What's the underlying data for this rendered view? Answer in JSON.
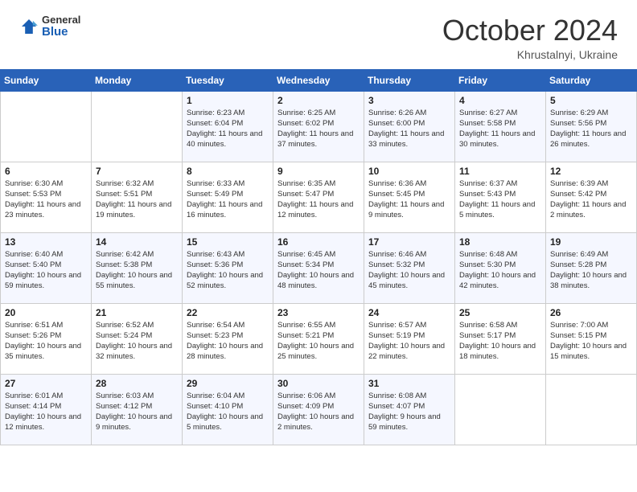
{
  "header": {
    "logo_general": "General",
    "logo_blue": "Blue",
    "month_title": "October 2024",
    "location": "Khrustalnyi, Ukraine"
  },
  "weekdays": [
    "Sunday",
    "Monday",
    "Tuesday",
    "Wednesday",
    "Thursday",
    "Friday",
    "Saturday"
  ],
  "weeks": [
    [
      {
        "day": "",
        "info": ""
      },
      {
        "day": "",
        "info": ""
      },
      {
        "day": "1",
        "info": "Sunrise: 6:23 AM\nSunset: 6:04 PM\nDaylight: 11 hours and 40 minutes."
      },
      {
        "day": "2",
        "info": "Sunrise: 6:25 AM\nSunset: 6:02 PM\nDaylight: 11 hours and 37 minutes."
      },
      {
        "day": "3",
        "info": "Sunrise: 6:26 AM\nSunset: 6:00 PM\nDaylight: 11 hours and 33 minutes."
      },
      {
        "day": "4",
        "info": "Sunrise: 6:27 AM\nSunset: 5:58 PM\nDaylight: 11 hours and 30 minutes."
      },
      {
        "day": "5",
        "info": "Sunrise: 6:29 AM\nSunset: 5:56 PM\nDaylight: 11 hours and 26 minutes."
      }
    ],
    [
      {
        "day": "6",
        "info": "Sunrise: 6:30 AM\nSunset: 5:53 PM\nDaylight: 11 hours and 23 minutes."
      },
      {
        "day": "7",
        "info": "Sunrise: 6:32 AM\nSunset: 5:51 PM\nDaylight: 11 hours and 19 minutes."
      },
      {
        "day": "8",
        "info": "Sunrise: 6:33 AM\nSunset: 5:49 PM\nDaylight: 11 hours and 16 minutes."
      },
      {
        "day": "9",
        "info": "Sunrise: 6:35 AM\nSunset: 5:47 PM\nDaylight: 11 hours and 12 minutes."
      },
      {
        "day": "10",
        "info": "Sunrise: 6:36 AM\nSunset: 5:45 PM\nDaylight: 11 hours and 9 minutes."
      },
      {
        "day": "11",
        "info": "Sunrise: 6:37 AM\nSunset: 5:43 PM\nDaylight: 11 hours and 5 minutes."
      },
      {
        "day": "12",
        "info": "Sunrise: 6:39 AM\nSunset: 5:42 PM\nDaylight: 11 hours and 2 minutes."
      }
    ],
    [
      {
        "day": "13",
        "info": "Sunrise: 6:40 AM\nSunset: 5:40 PM\nDaylight: 10 hours and 59 minutes."
      },
      {
        "day": "14",
        "info": "Sunrise: 6:42 AM\nSunset: 5:38 PM\nDaylight: 10 hours and 55 minutes."
      },
      {
        "day": "15",
        "info": "Sunrise: 6:43 AM\nSunset: 5:36 PM\nDaylight: 10 hours and 52 minutes."
      },
      {
        "day": "16",
        "info": "Sunrise: 6:45 AM\nSunset: 5:34 PM\nDaylight: 10 hours and 48 minutes."
      },
      {
        "day": "17",
        "info": "Sunrise: 6:46 AM\nSunset: 5:32 PM\nDaylight: 10 hours and 45 minutes."
      },
      {
        "day": "18",
        "info": "Sunrise: 6:48 AM\nSunset: 5:30 PM\nDaylight: 10 hours and 42 minutes."
      },
      {
        "day": "19",
        "info": "Sunrise: 6:49 AM\nSunset: 5:28 PM\nDaylight: 10 hours and 38 minutes."
      }
    ],
    [
      {
        "day": "20",
        "info": "Sunrise: 6:51 AM\nSunset: 5:26 PM\nDaylight: 10 hours and 35 minutes."
      },
      {
        "day": "21",
        "info": "Sunrise: 6:52 AM\nSunset: 5:24 PM\nDaylight: 10 hours and 32 minutes."
      },
      {
        "day": "22",
        "info": "Sunrise: 6:54 AM\nSunset: 5:23 PM\nDaylight: 10 hours and 28 minutes."
      },
      {
        "day": "23",
        "info": "Sunrise: 6:55 AM\nSunset: 5:21 PM\nDaylight: 10 hours and 25 minutes."
      },
      {
        "day": "24",
        "info": "Sunrise: 6:57 AM\nSunset: 5:19 PM\nDaylight: 10 hours and 22 minutes."
      },
      {
        "day": "25",
        "info": "Sunrise: 6:58 AM\nSunset: 5:17 PM\nDaylight: 10 hours and 18 minutes."
      },
      {
        "day": "26",
        "info": "Sunrise: 7:00 AM\nSunset: 5:15 PM\nDaylight: 10 hours and 15 minutes."
      }
    ],
    [
      {
        "day": "27",
        "info": "Sunrise: 6:01 AM\nSunset: 4:14 PM\nDaylight: 10 hours and 12 minutes."
      },
      {
        "day": "28",
        "info": "Sunrise: 6:03 AM\nSunset: 4:12 PM\nDaylight: 10 hours and 9 minutes."
      },
      {
        "day": "29",
        "info": "Sunrise: 6:04 AM\nSunset: 4:10 PM\nDaylight: 10 hours and 5 minutes."
      },
      {
        "day": "30",
        "info": "Sunrise: 6:06 AM\nSunset: 4:09 PM\nDaylight: 10 hours and 2 minutes."
      },
      {
        "day": "31",
        "info": "Sunrise: 6:08 AM\nSunset: 4:07 PM\nDaylight: 9 hours and 59 minutes."
      },
      {
        "day": "",
        "info": ""
      },
      {
        "day": "",
        "info": ""
      }
    ]
  ]
}
